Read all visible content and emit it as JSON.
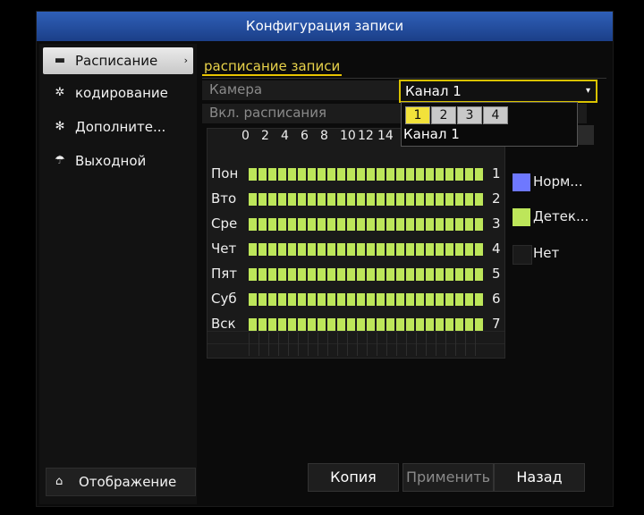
{
  "window": {
    "title": "Конфигурация записи"
  },
  "sidebar": {
    "items": [
      {
        "label": "Расписание",
        "icon": "schedule-icon",
        "active": true,
        "arrow": "›"
      },
      {
        "label": "кодирование",
        "icon": "encoding-gear-icon",
        "active": false
      },
      {
        "label": "Дополните...",
        "icon": "advanced-gears-icon",
        "active": false
      },
      {
        "label": "Выходной",
        "icon": "holiday-umbrella-icon",
        "active": false
      }
    ],
    "bottom_button": {
      "label": "Отображение",
      "icon": "home-icon"
    }
  },
  "main": {
    "tab": "расписание записи",
    "camera_label": "Камера",
    "camera_value": "Канал 1",
    "enable_label": "Вкл. расписания",
    "dropdown": {
      "tabs": [
        "1",
        "2",
        "3",
        "4"
      ],
      "selected_tab": "1",
      "items": [
        "Канал 1"
      ]
    },
    "hours": [
      "0",
      "2",
      "4",
      "6",
      "8",
      "10",
      "12",
      "14"
    ],
    "days": [
      {
        "name": "Пон",
        "num": "1"
      },
      {
        "name": "Вто",
        "num": "2"
      },
      {
        "name": "Сре",
        "num": "3"
      },
      {
        "name": "Чет",
        "num": "4"
      },
      {
        "name": "Пят",
        "num": "5"
      },
      {
        "name": "Суб",
        "num": "6"
      },
      {
        "name": "Вск",
        "num": "7"
      }
    ],
    "schedule_fill_fraction": 1.0,
    "legend": [
      {
        "label": "Норм...",
        "color": "#6e78ff"
      },
      {
        "label": "Детек...",
        "color": "#bde65a"
      },
      {
        "label": "Нет",
        "color": "#1a1a1a"
      }
    ]
  },
  "buttons": {
    "copy": "Копия",
    "apply": "Применить",
    "back": "Назад"
  },
  "colors": {
    "title_bar": "#2550a8",
    "accent": "#e8c400",
    "schedule_bar": "#bde65a"
  }
}
